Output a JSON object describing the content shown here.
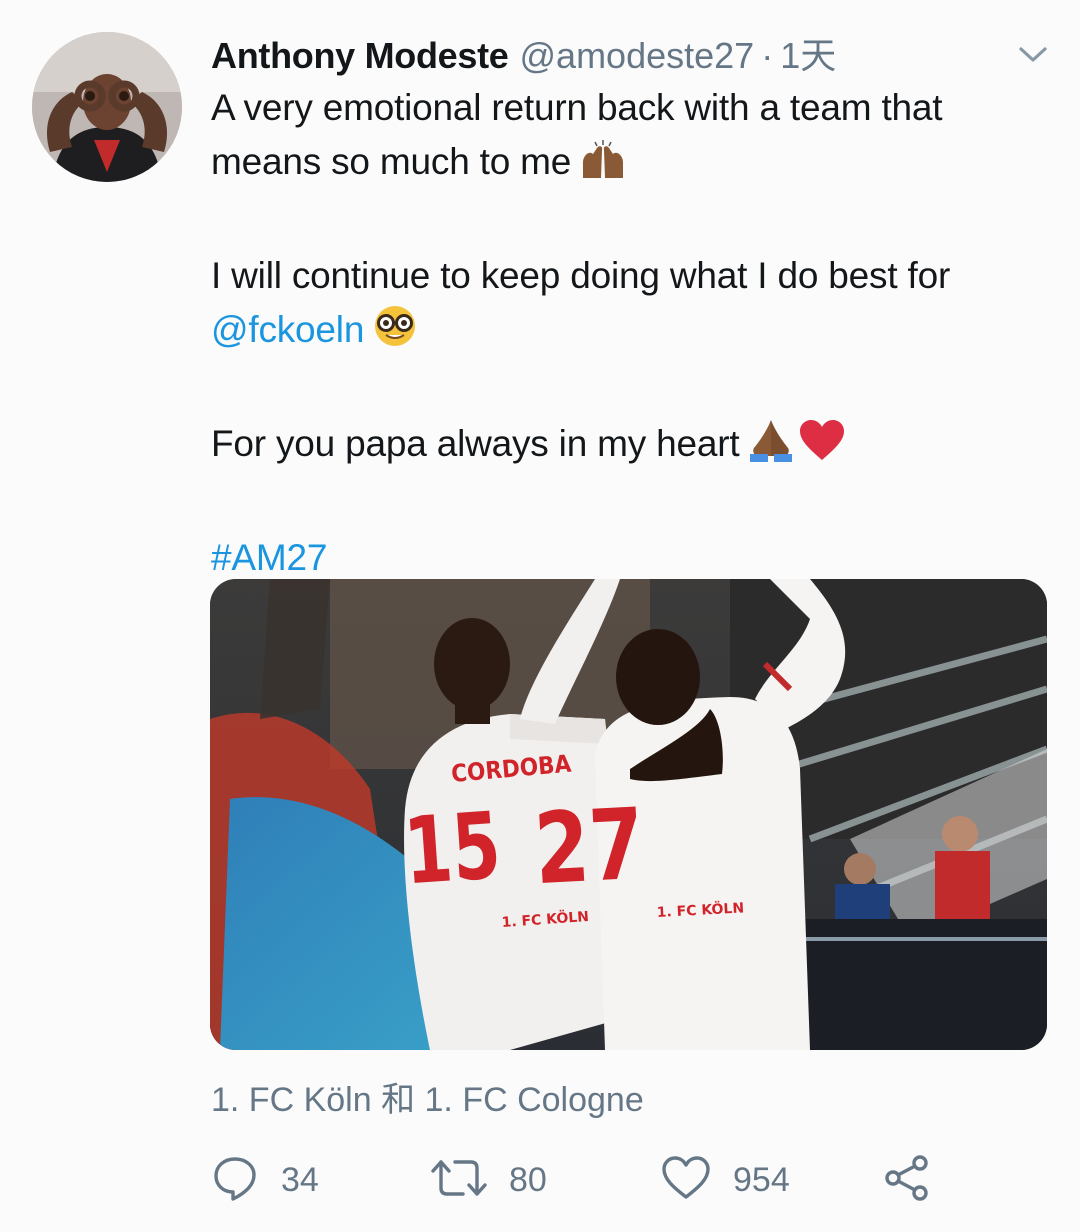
{
  "tweet": {
    "author_name": "Anthony Modeste",
    "author_handle": "@amodeste27",
    "separator": "·",
    "timestamp": "1天",
    "lines": {
      "p1_line1": "A very emotional return back with a team that",
      "p1_line2": "means so much to me",
      "p2_line1": "I will continue to keep doing what I do best for",
      "p2_mention": "@fckoeln",
      "p3": "For you papa always in my heart",
      "hashtag": "#AM27"
    },
    "emoji": {
      "raising_hands": "raising-hands-icon",
      "nerd_face": "nerd-face-icon",
      "folded_hands": "folded-hands-icon",
      "heart": "red-heart-icon"
    },
    "media": {
      "jersey_left_name": "CORDOBA",
      "jersey_left_number": "15",
      "jersey_left_club": "1. FC KÖLN",
      "jersey_right_number": "27",
      "jersey_right_club": "1. FC KÖLN"
    },
    "tagged": "1. FC Köln 和 1. FC Cologne",
    "stats": {
      "replies": "34",
      "retweets": "80",
      "likes": "954"
    }
  },
  "colors": {
    "text": "#14171a",
    "secondary": "#657786",
    "link": "#1b95e0",
    "jersey_red": "#d0232a"
  }
}
